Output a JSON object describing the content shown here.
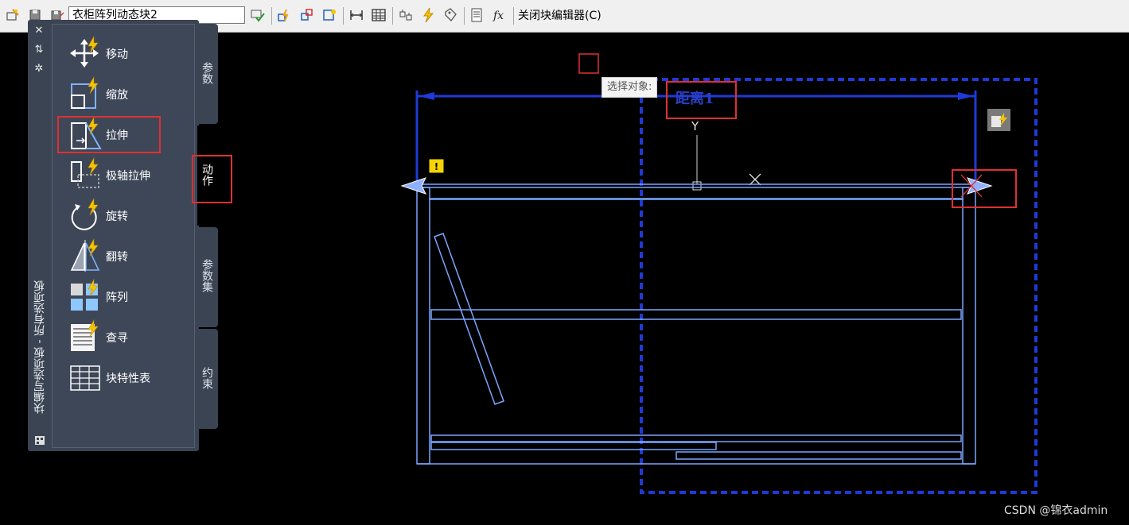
{
  "toolbar": {
    "block_name": "衣柜阵列动态块2",
    "close_label": "关闭块编辑器(C)",
    "icons": [
      "edit-block-icon",
      "save-block-icon",
      "save-block-as-icon",
      "test-block-icon",
      "authoring-parameters-icon",
      "point-parameter-icon",
      "attribute-definition-icon",
      "visibility-icon",
      "lookup-table-icon",
      "parameter-manager-icon",
      "action-icon",
      "block-properties-icon",
      "define-attributes-icon",
      "fx-icon"
    ]
  },
  "palette": {
    "title": "块编写选项板 - 所有选项板",
    "items": [
      {
        "label": "移动",
        "icon": "move-action-icon"
      },
      {
        "label": "缩放",
        "icon": "scale-action-icon"
      },
      {
        "label": "拉伸",
        "icon": "stretch-action-icon"
      },
      {
        "label": "极轴拉伸",
        "icon": "polar-stretch-action-icon"
      },
      {
        "label": "旋转",
        "icon": "rotate-action-icon"
      },
      {
        "label": "翻转",
        "icon": "flip-action-icon"
      },
      {
        "label": "阵列",
        "icon": "array-action-icon"
      },
      {
        "label": "查寻",
        "icon": "lookup-action-icon"
      },
      {
        "label": "块特性表",
        "icon": "block-table-icon"
      }
    ],
    "tabs": [
      {
        "label": "参数"
      },
      {
        "label": "动作"
      },
      {
        "label": "参数集"
      },
      {
        "label": "约束"
      }
    ]
  },
  "canvas": {
    "tooltip": "选择对象:",
    "dimension_label": "距离1",
    "grip_label": "Y"
  },
  "watermark": "CSDN @锦衣admin",
  "colors": {
    "highlight": "#e03030",
    "geometry": "#7aa6ff",
    "dimension": "#2a3fc8",
    "accent": "#f5c400"
  }
}
